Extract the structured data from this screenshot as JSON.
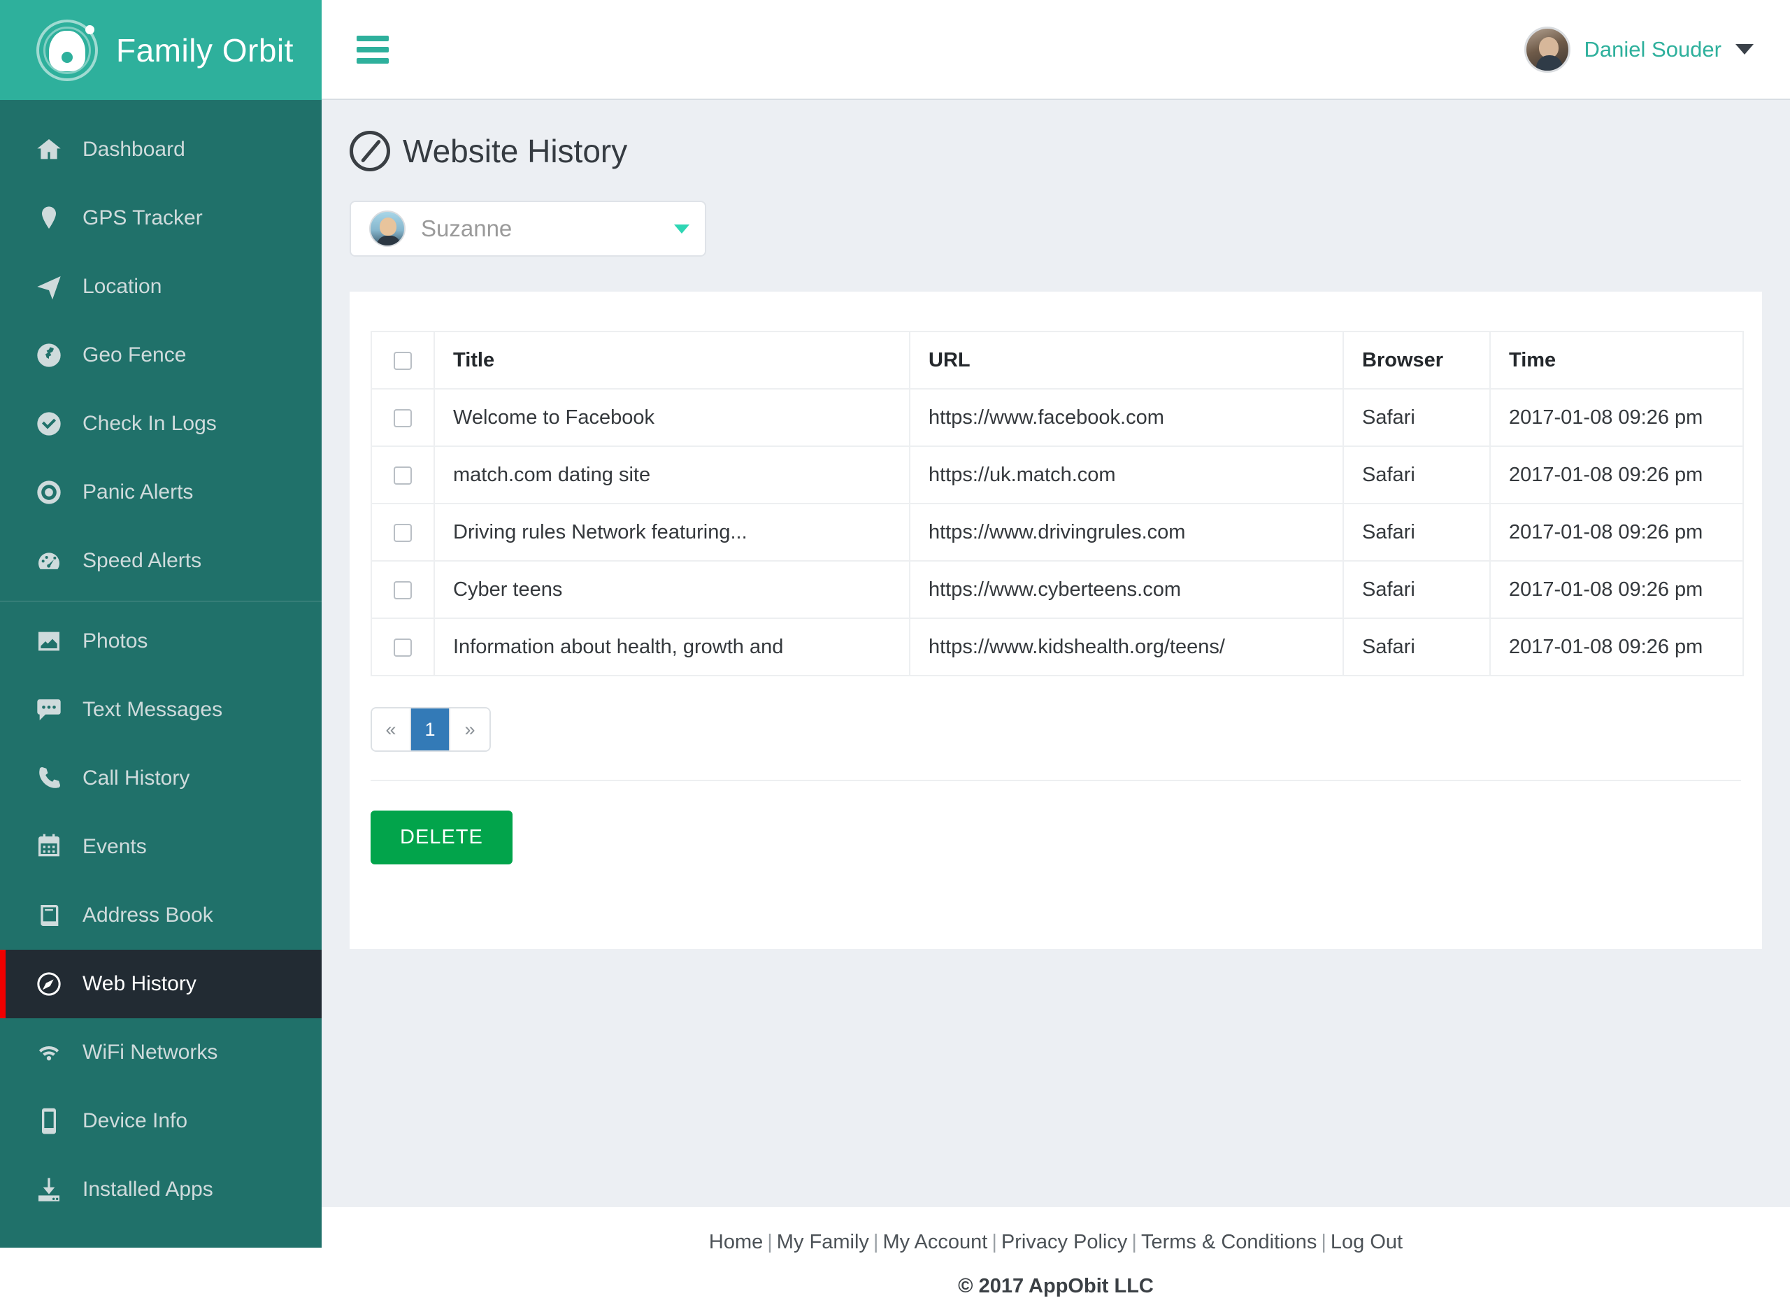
{
  "brand": {
    "name": "Family Orbit",
    "logo_icon": "family-orbit-logo"
  },
  "topbar": {
    "menu_icon": "hamburger-menu-icon",
    "user_name": "Daniel Souder",
    "avatar_icon": "user-avatar",
    "caret_icon": "chevron-down-icon"
  },
  "sidebar": {
    "items": [
      {
        "label": "Dashboard",
        "icon": "home-icon",
        "active": false
      },
      {
        "label": "GPS Tracker",
        "icon": "map-marker-icon",
        "active": false
      },
      {
        "label": "Location",
        "icon": "paper-plane-icon",
        "active": false
      },
      {
        "label": "Geo Fence",
        "icon": "globe-icon",
        "active": false
      },
      {
        "label": "Check In Logs",
        "icon": "check-circle-icon",
        "active": false
      },
      {
        "label": "Panic Alerts",
        "icon": "life-ring-icon",
        "active": false
      },
      {
        "label": "Speed Alerts",
        "icon": "tachometer-icon",
        "active": false
      },
      {
        "label": "Photos",
        "icon": "photo-icon",
        "active": false
      },
      {
        "label": "Text Messages",
        "icon": "comment-icon",
        "active": false
      },
      {
        "label": "Call History",
        "icon": "phone-icon",
        "active": false
      },
      {
        "label": "Events",
        "icon": "calendar-icon",
        "active": false
      },
      {
        "label": "Address Book",
        "icon": "book-icon",
        "active": false
      },
      {
        "label": "Web History",
        "icon": "compass-icon",
        "active": true
      },
      {
        "label": "WiFi Networks",
        "icon": "wifi-icon",
        "active": false
      },
      {
        "label": "Device Info",
        "icon": "mobile-icon",
        "active": false
      },
      {
        "label": "Installed Apps",
        "icon": "download-icon",
        "active": false
      }
    ],
    "divider_after_index": 6
  },
  "page": {
    "title": "Website History",
    "title_icon": "compass-icon"
  },
  "child_selector": {
    "selected": "Suzanne",
    "avatar_icon": "child-avatar",
    "caret_icon": "caret-down-icon"
  },
  "table": {
    "select_all_icon": "checkbox-unchecked",
    "columns": [
      "Title",
      "URL",
      "Browser",
      "Time"
    ],
    "rows": [
      {
        "title": "Welcome to Facebook",
        "url": "https://www.facebook.com",
        "browser": "Safari",
        "time": "2017-01-08 09:26 pm"
      },
      {
        "title": "match.com dating site",
        "url": "https://uk.match.com",
        "browser": "Safari",
        "time": "2017-01-08 09:26 pm"
      },
      {
        "title": "Driving rules Network featuring...",
        "url": "https://www.drivingrules.com",
        "browser": "Safari",
        "time": "2017-01-08 09:26 pm"
      },
      {
        "title": "Cyber teens",
        "url": "https://www.cyberteens.com",
        "browser": "Safari",
        "time": "2017-01-08 09:26 pm"
      },
      {
        "title": "Information about health, growth and",
        "url": "https://www.kidshealth.org/teens/",
        "browser": "Safari",
        "time": "2017-01-08 09:26 pm"
      }
    ]
  },
  "pagination": {
    "prev": "«",
    "next": "»",
    "pages": [
      "1"
    ],
    "current": "1"
  },
  "actions": {
    "delete_label": "DELETE"
  },
  "footer": {
    "links": [
      "Home",
      "My Family",
      "My Account",
      "Privacy Policy",
      "Terms & Conditions",
      "Log Out"
    ],
    "copyright": "© 2017 AppObit LLC"
  },
  "colors": {
    "brand_teal": "#2eb09c",
    "sidebar_teal": "#20716a",
    "active_item_bg": "#222b33",
    "active_item_accent": "#f00000",
    "page_bg": "#eceff3",
    "delete_green": "#02a44b",
    "pager_active_blue": "#337ab7"
  }
}
